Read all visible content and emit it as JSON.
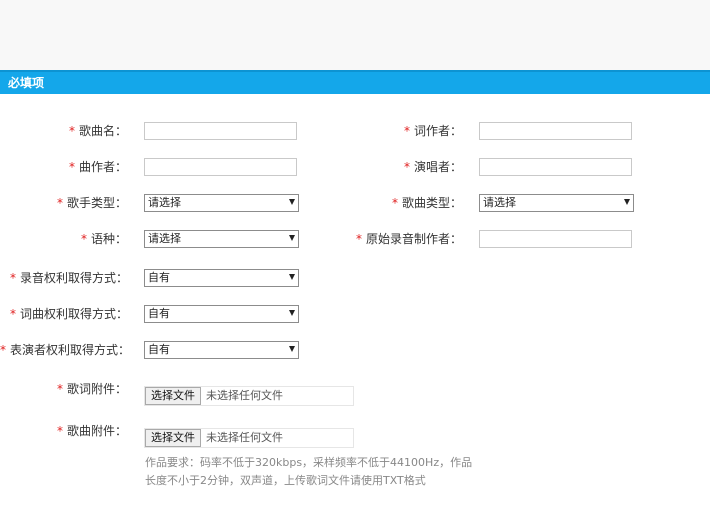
{
  "section": {
    "title": "必填项"
  },
  "required_mark": "*",
  "fields": {
    "song_name": {
      "label": "歌曲名："
    },
    "lyricist": {
      "label": "词作者："
    },
    "composer": {
      "label": "曲作者："
    },
    "singer": {
      "label": "演唱者："
    },
    "singer_type": {
      "label": "歌手类型：",
      "value": "请选择"
    },
    "song_type": {
      "label": "歌曲类型：",
      "value": "请选择"
    },
    "language": {
      "label": "语种：",
      "value": "请选择"
    },
    "original_producer": {
      "label": "原始录音制作者："
    },
    "recording_rights": {
      "label": "录音权利取得方式：",
      "value": "自有"
    },
    "lyric_music_rights": {
      "label": "词曲权利取得方式：",
      "value": "自有"
    },
    "performer_rights": {
      "label": "表演者权利取得方式：",
      "value": "自有"
    },
    "lyrics_attachment": {
      "label": "歌词附件：",
      "button": "选择文件",
      "status": "未选择任何文件"
    },
    "song_attachment": {
      "label": "歌曲附件：",
      "button": "选择文件",
      "status": "未选择任何文件"
    }
  },
  "note": {
    "line1": "作品要求：码率不低于320kbps，采样频率不低于44100Hz，作品",
    "line2": "长度不小于2分钟，双声道，上传歌词文件请使用TXT格式"
  }
}
